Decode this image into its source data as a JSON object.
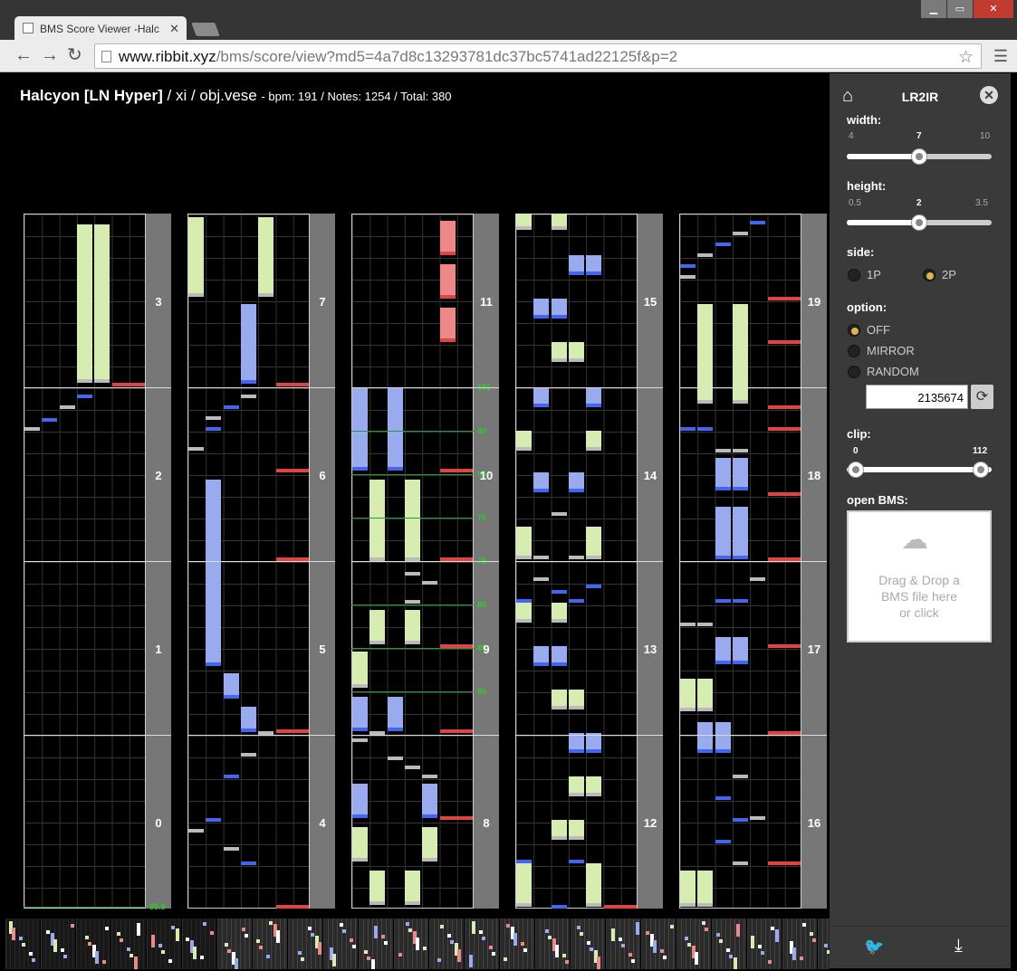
{
  "browser": {
    "tab_title": "BMS Score Viewer -Halc",
    "url_host": "www.ribbit.xyz",
    "url_path": "/bms/score/view?md5=4a7d8c13293781dc37bc5741ad22125f&p=2",
    "window_controls": [
      "minimize-icon",
      "maximize-icon",
      "close-icon"
    ]
  },
  "header": {
    "title": "Halcyon [LN Hyper]",
    "artist": "xi",
    "obj": "obj.vese",
    "meta": "- bpm: 191 / Notes: 1254 / Total: 380"
  },
  "measures": [
    {
      "col": 0,
      "nums": [
        "3",
        "2",
        "1",
        "0"
      ]
    },
    {
      "col": 1,
      "nums": [
        "7",
        "6",
        "5",
        "4"
      ]
    },
    {
      "col": 2,
      "nums": [
        "11",
        "10",
        "9",
        "8"
      ]
    },
    {
      "col": 3,
      "nums": [
        "15",
        "14",
        "13",
        "12"
      ]
    },
    {
      "col": 4,
      "nums": [
        "19",
        "18",
        "17",
        "16"
      ]
    }
  ],
  "bpm_labels": [
    "191",
    "40",
    "50",
    "70",
    "75",
    "80",
    "85",
    "90",
    "95.5"
  ],
  "panel": {
    "brand": "LR2IR",
    "width_label": "width:",
    "width_min": "4",
    "width_value": "7",
    "width_max": "10",
    "width_fraction": 0.5,
    "height_label": "height:",
    "height_min": "0.5",
    "height_value": "2",
    "height_max": "3.5",
    "height_fraction": 0.5,
    "side_label": "side:",
    "side_options": [
      "1P",
      "2P"
    ],
    "side_selected": "2P",
    "option_label": "option:",
    "option_choices": [
      "OFF",
      "MIRROR",
      "RANDOM"
    ],
    "option_selected": "OFF",
    "seed_value": "2135674",
    "clip_label": "clip:",
    "clip_min": "0",
    "clip_max": "112",
    "open_label": "open BMS:",
    "drop_line1": "Drag & Drop a",
    "drop_line2": "BMS file here",
    "drop_line3": "or click"
  }
}
